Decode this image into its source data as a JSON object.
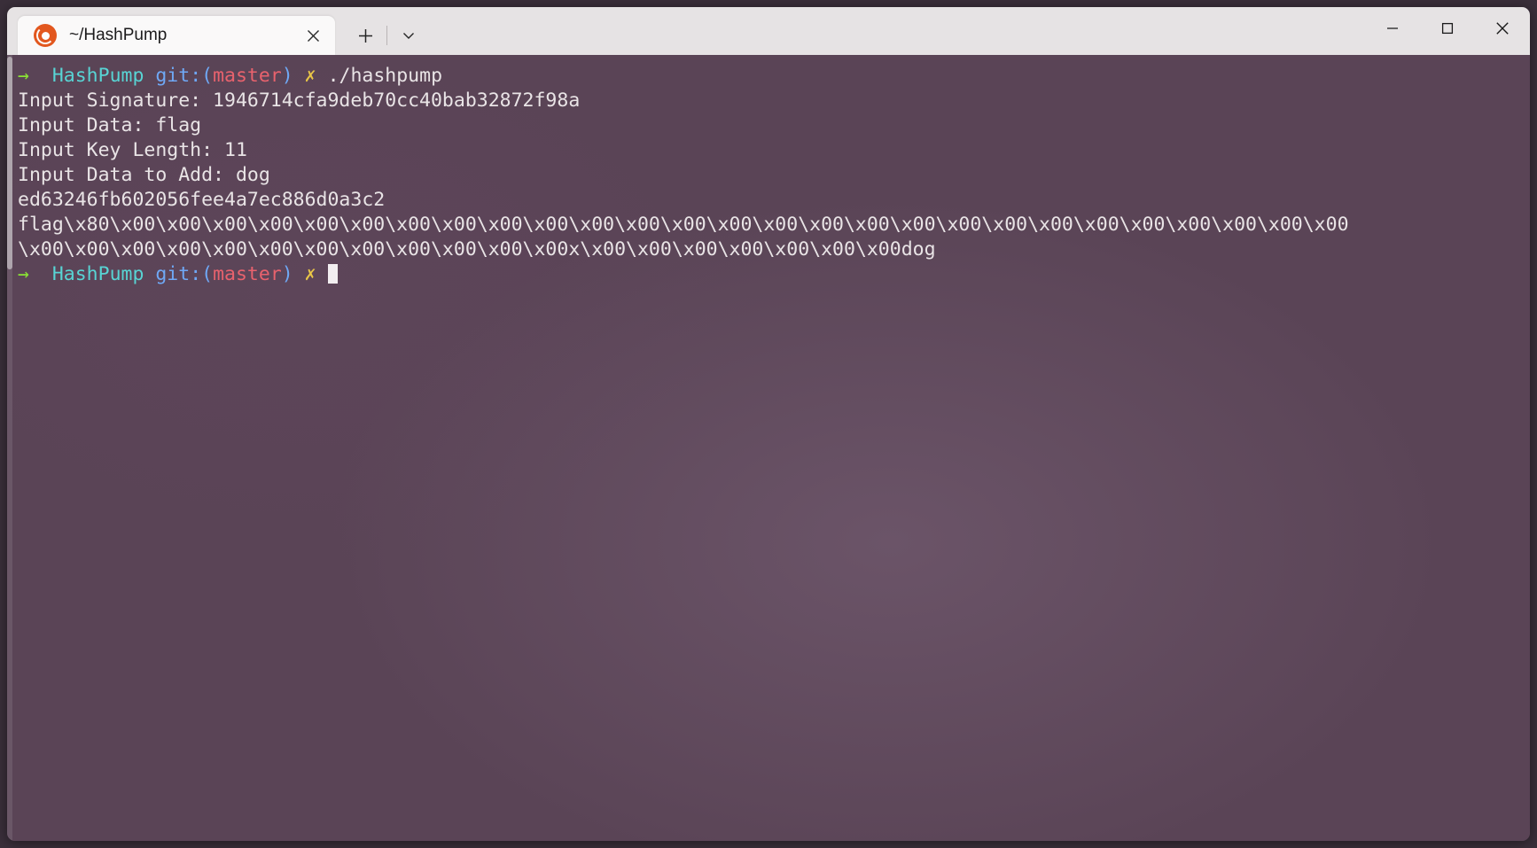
{
  "window": {
    "tab": {
      "title": "~/HashPump",
      "icon": "ubuntu-logo-icon",
      "close_label": "✕"
    },
    "new_tab_label": "+",
    "tab_menu_label": "⌄",
    "controls": {
      "minimize": "—",
      "maximize": "□",
      "close": "✕"
    }
  },
  "colors": {
    "titlebar_bg": "#e6e3e4",
    "tab_bg": "#faf9f9",
    "terminal_bg": "#5a4456",
    "text": "#e9e4e6",
    "prompt_arrow": "#8ae234",
    "prompt_path": "#58d4d4",
    "prompt_git": "#6fa8f5",
    "prompt_branch": "#e8626d",
    "prompt_mark": "#e8c547",
    "ubuntu_orange": "#e2571e"
  },
  "terminal": {
    "prompt": {
      "arrow": "→",
      "path": "HashPump",
      "git_open": "git:(",
      "branch": "master",
      "git_close": ")",
      "mark": "✗"
    },
    "command": "./hashpump",
    "output": {
      "signature_line": "Input Signature: 1946714cfa9deb70cc40bab32872f98a",
      "data_line": "Input Data: flag",
      "keylength_line": "Input Key Length: 11",
      "dataadd_line": "Input Data to Add: dog",
      "digest_line": "ed63246fb602056fee4a7ec886d0a3c2",
      "payload_line_1": "flag\\x80\\x00\\x00\\x00\\x00\\x00\\x00\\x00\\x00\\x00\\x00\\x00\\x00\\x00\\x00\\x00\\x00\\x00\\x00\\x00\\x00\\x00\\x00\\x00\\x00\\x00\\x00\\x00",
      "payload_line_2": "\\x00\\x00\\x00\\x00\\x00\\x00\\x00\\x00\\x00\\x00\\x00\\x00x\\x00\\x00\\x00\\x00\\x00\\x00\\x00dog"
    }
  }
}
